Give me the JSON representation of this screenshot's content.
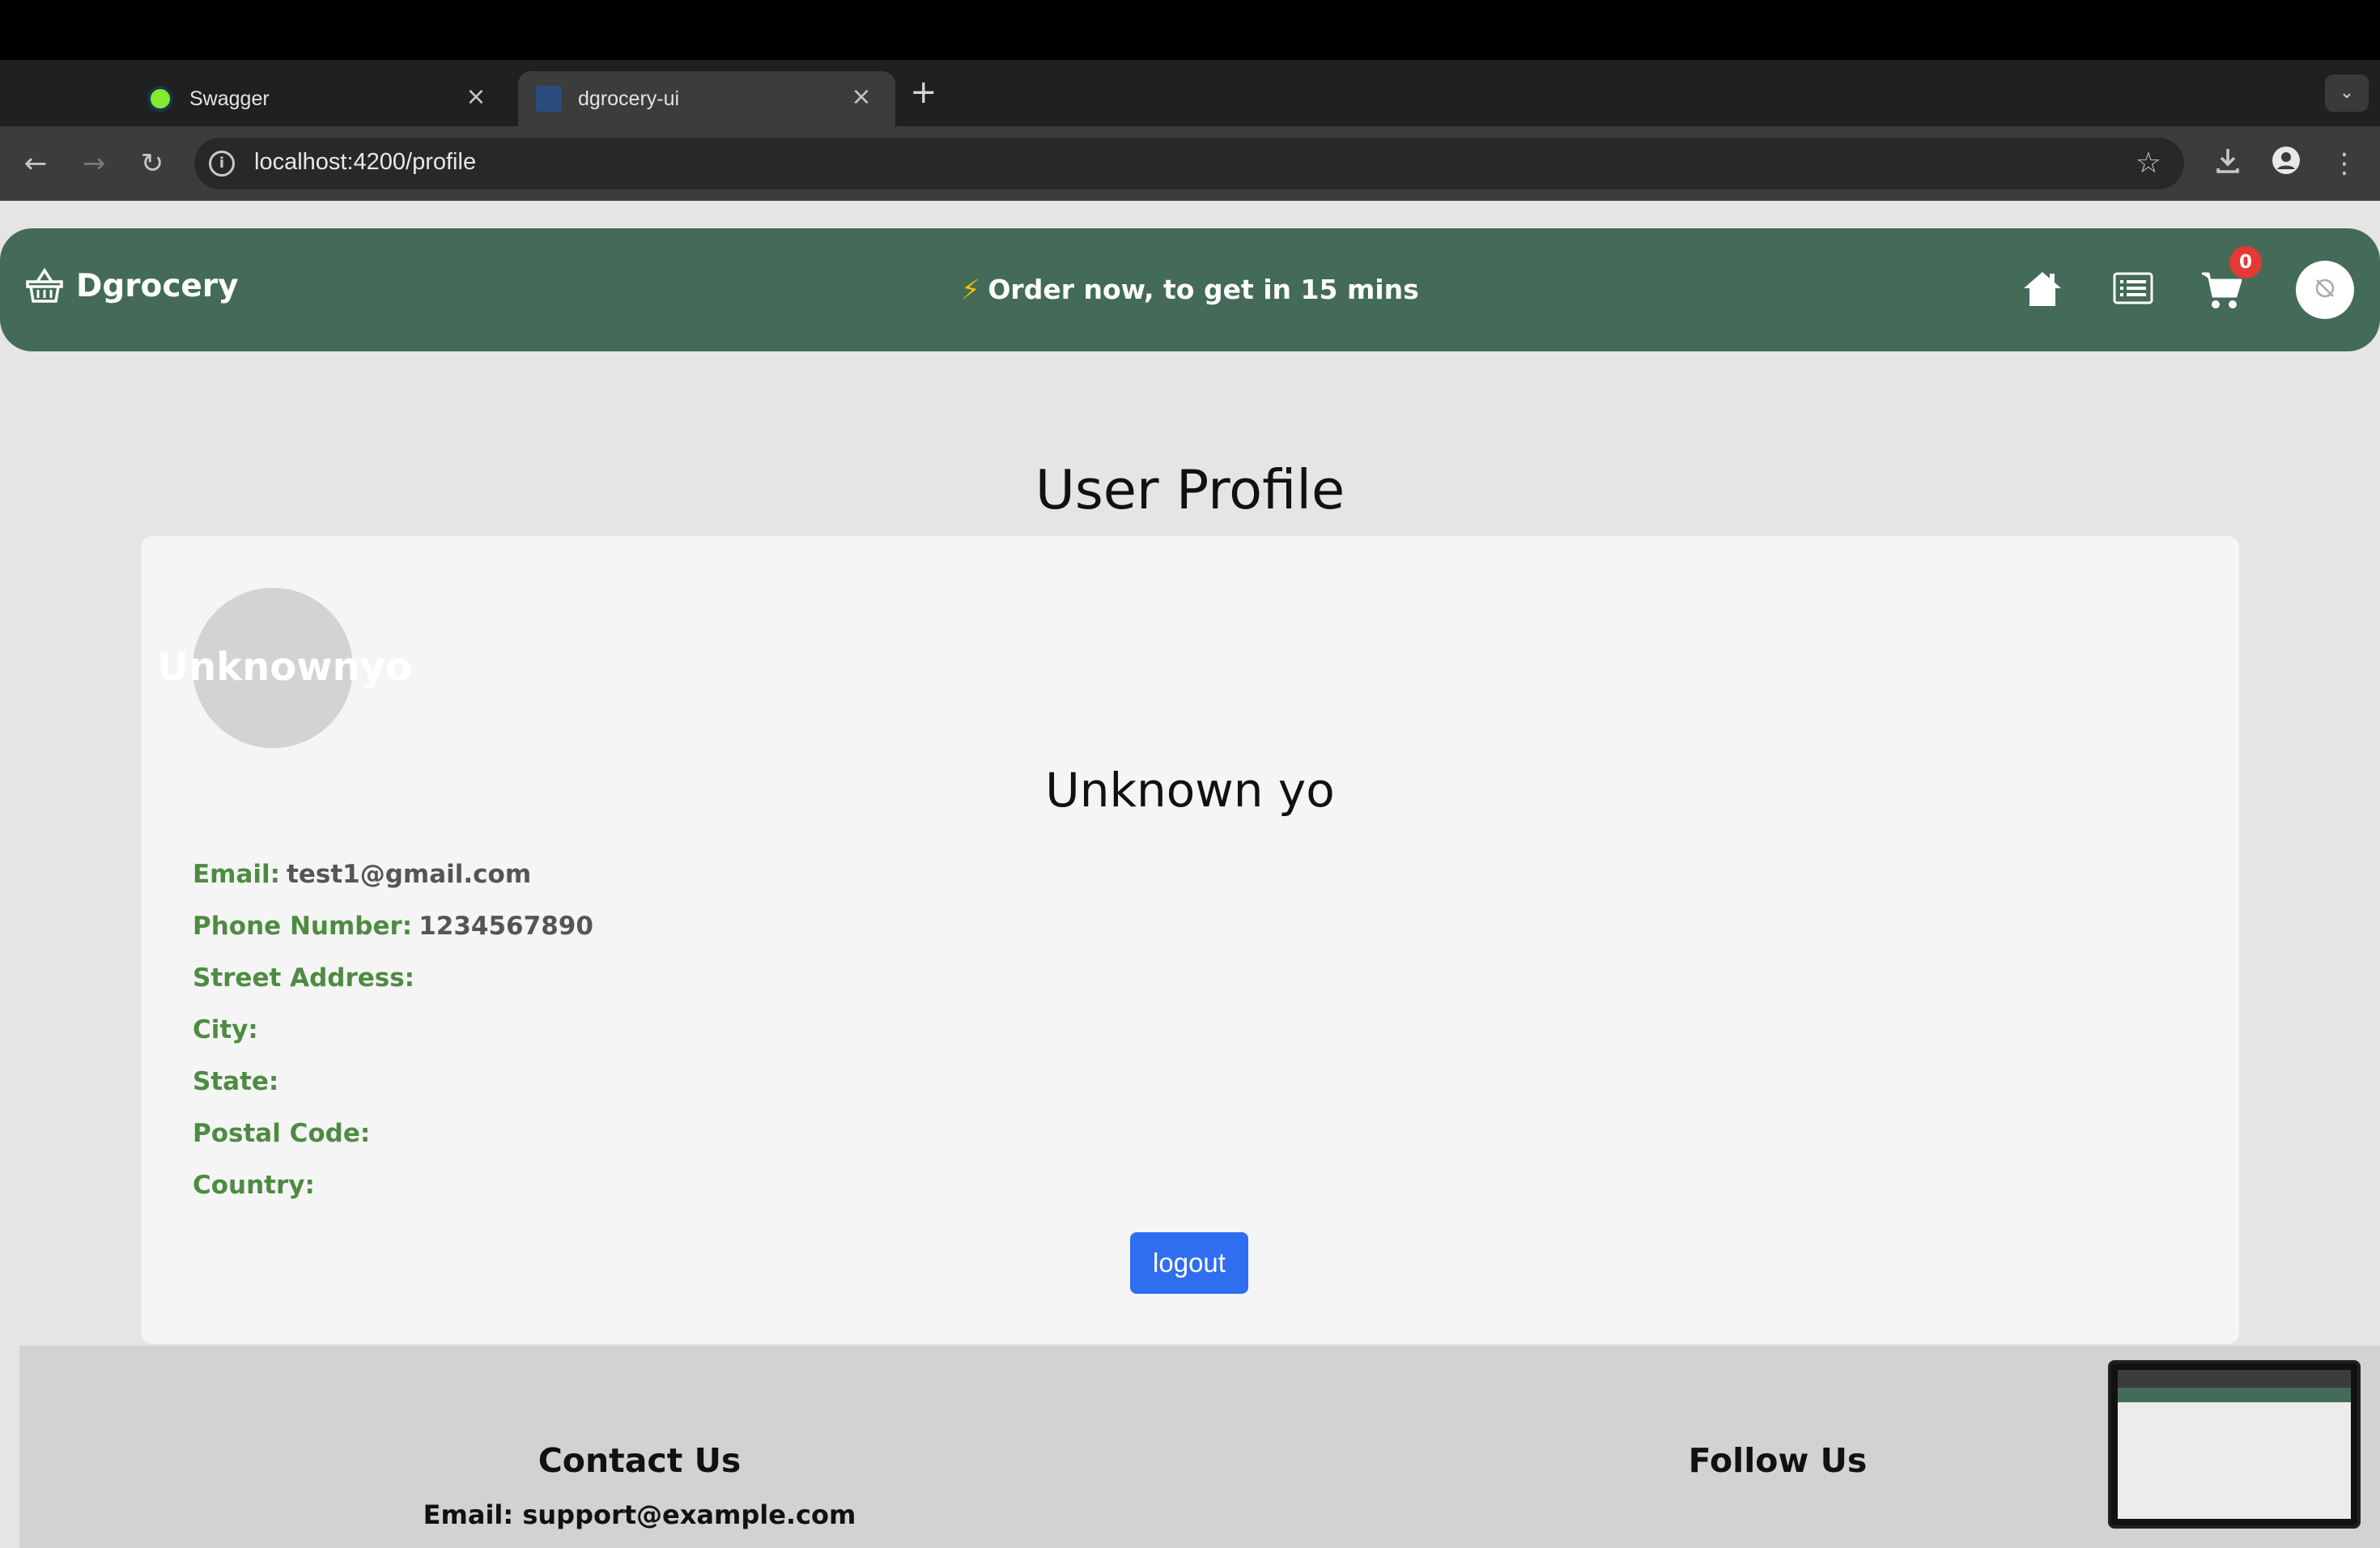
{
  "browser": {
    "tabs": [
      {
        "title": "Swagger",
        "active": false
      },
      {
        "title": "dgrocery-ui",
        "active": true
      }
    ],
    "url": "localhost:4200/profile"
  },
  "header": {
    "brand": "Dgrocery",
    "promo": "Order now, to get in 15 mins",
    "cart_count": "0"
  },
  "profile": {
    "page_title": "User Profile",
    "avatar_text": "Unknownyo",
    "name": "Unknown yo",
    "fields": [
      {
        "label": "Email:",
        "value": "test1@gmail.com"
      },
      {
        "label": "Phone Number:",
        "value": "1234567890"
      },
      {
        "label": "Street Address:",
        "value": ""
      },
      {
        "label": "City:",
        "value": ""
      },
      {
        "label": "State:",
        "value": ""
      },
      {
        "label": "Postal Code:",
        "value": ""
      },
      {
        "label": "Country:",
        "value": ""
      }
    ],
    "logout_label": "logout"
  },
  "footer": {
    "contact_heading": "Contact Us",
    "contact_email": "Email: support@example.com",
    "follow_heading": "Follow Us"
  },
  "colors": {
    "header_bg": "#436b57",
    "label_green": "#4e8b42",
    "logout_blue": "#2f6ef0",
    "badge_red": "#e53935"
  }
}
